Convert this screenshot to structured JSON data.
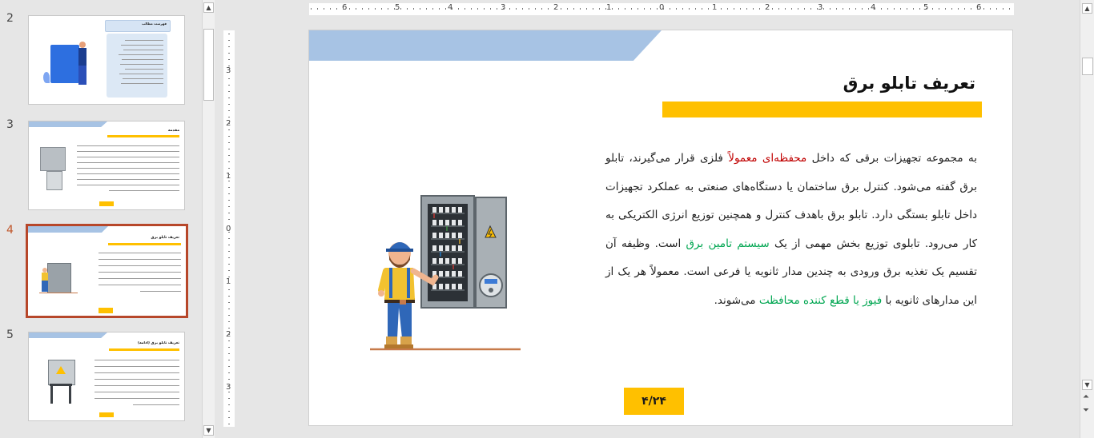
{
  "thumbnails": [
    {
      "number": "2",
      "title": "فهرست مطالب",
      "active": false
    },
    {
      "number": "3",
      "title": "مقدمه",
      "active": false
    },
    {
      "number": "4",
      "title": "تعریف تابلو برق",
      "active": true
    },
    {
      "number": "5",
      "title": "تعریف تابلو برق (ادامه)",
      "active": false
    }
  ],
  "ruler": {
    "h_labels": [
      "6",
      "5",
      "4",
      "3",
      "2",
      "1",
      "0",
      "1",
      "2",
      "3",
      "4",
      "5",
      "6"
    ],
    "v_labels": [
      "3",
      "2",
      "1",
      "0",
      "1",
      "2",
      "3"
    ]
  },
  "slide": {
    "title": "تعریف تابلو برق",
    "body": {
      "s1": "به مجموعه تجهیزات برقی که داخل ",
      "h1": "محفظه‌ای معمولاً",
      "s2": " فلزی قرار می‌گیرند، تابلو برق گفته می‌شود. کنترل برق ساختمان یا دستگاه‌های صنعتی به عملکرد تجهیزات داخل تابلو بستگی دارد. تابلو برق باهدف کنترل و همچنین توزیع انرژی الکتریکی به کار می‌رود. تابلوی توزیع بخش مهمی از یک ",
      "h2": "سیستم تامین برق",
      "s3": " است. وظیفه آن تقسیم یک تغذیه برق ورودی به چندین مدار ثانویه یا فرعی است. معمولاً هر یک از این مدارهای ثانویه با ",
      "h3": "فیوز یا قطع کننده محافظت",
      "s4": " می‌شوند."
    },
    "page_number": "۴/۲۴"
  },
  "colors": {
    "accent_yellow": "#ffc000",
    "banner_blue": "#a7c3e4",
    "highlight_red": "#c00000",
    "highlight_green": "#00a651",
    "active_border": "#b7472a"
  }
}
